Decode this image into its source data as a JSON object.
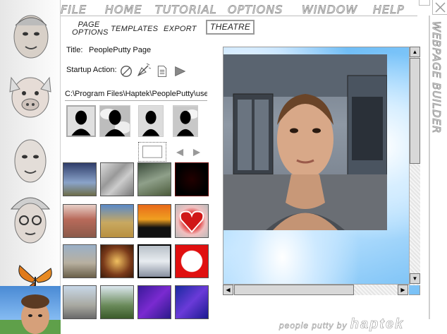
{
  "menu": {
    "items": [
      "FILE",
      "HOME",
      "TUTORIAL",
      "OPTIONS",
      "WINDOW",
      "HELP"
    ]
  },
  "window_title": "WEBPAGE BUILDER",
  "tabs": {
    "page_options": "PAGE OPTIONS",
    "templates": "TEMPLATES",
    "export": "EXPORT",
    "theatre": "THEATRE"
  },
  "form": {
    "title_label": "Title:",
    "title_value": "PeoplePutty Page",
    "startup_label": "Startup Action:",
    "path_value": "C:\\Program Files\\Haptek\\PeoplePutty\\use"
  },
  "footer": {
    "text": "people putty by",
    "brand": "haptek"
  },
  "icons": {
    "none": "no-action-icon",
    "wave": "wand-icon",
    "script": "document-icon",
    "play": "play-icon",
    "prev": "arrow-left-icon",
    "next": "arrow-right-icon",
    "blank": "blank-frame-icon"
  },
  "colors": {
    "menu_outline": "#9a9a9a",
    "sky": "#8fd0ff",
    "theatre_border": "#999999"
  }
}
